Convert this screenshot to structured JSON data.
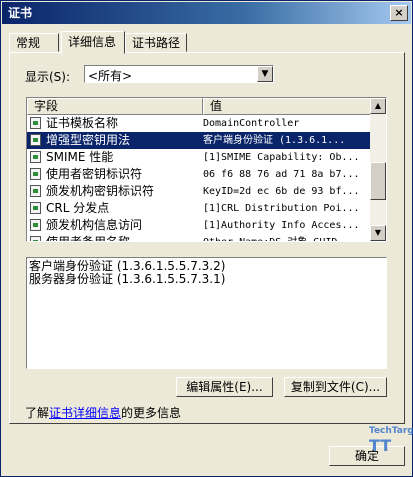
{
  "window": {
    "title": "证书",
    "close_glyph": "×"
  },
  "tabs": [
    {
      "label": "常规"
    },
    {
      "label": "详细信息"
    },
    {
      "label": "证书路径"
    }
  ],
  "show": {
    "label": "显示(S):",
    "selected": "<所有>"
  },
  "columns": {
    "field": "字段",
    "value": "值"
  },
  "rows": [
    {
      "field": "证书模板名称",
      "value": "DomainController"
    },
    {
      "field": "增强型密钥用法",
      "value": "客户端身份验证 (1.3.6.1..."
    },
    {
      "field": "SMIME 性能",
      "value": "[1]SMIME Capability: Ob..."
    },
    {
      "field": "使用者密钥标识符",
      "value": "06 f6 88 76 ad 71 8a b7..."
    },
    {
      "field": "颁发机构密钥标识符",
      "value": "KeyID=2d ec 6b de 93 bf..."
    },
    {
      "field": "CRL 分发点",
      "value": "[1]CRL Distribution Poi..."
    },
    {
      "field": "颁发机构信息访问",
      "value": "[1]Authority Info Acces..."
    },
    {
      "field": "使用者备用名称",
      "value": "Other Name:DS 对象 GUID..."
    }
  ],
  "detail_lines": [
    "客户端身份验证 (1.3.6.1.5.5.7.3.2)",
    "服务器身份验证 (1.3.6.1.5.5.7.3.1)"
  ],
  "buttons": {
    "edit_properties": "编辑属性(E)...",
    "copy_to_file": "复制到文件(C)...",
    "ok": "确定"
  },
  "learn": {
    "prefix": "了解",
    "link": "证书详细信息",
    "suffix": "的更多信息"
  },
  "watermark": {
    "line1": "TechTarget",
    "line2": "TT"
  }
}
